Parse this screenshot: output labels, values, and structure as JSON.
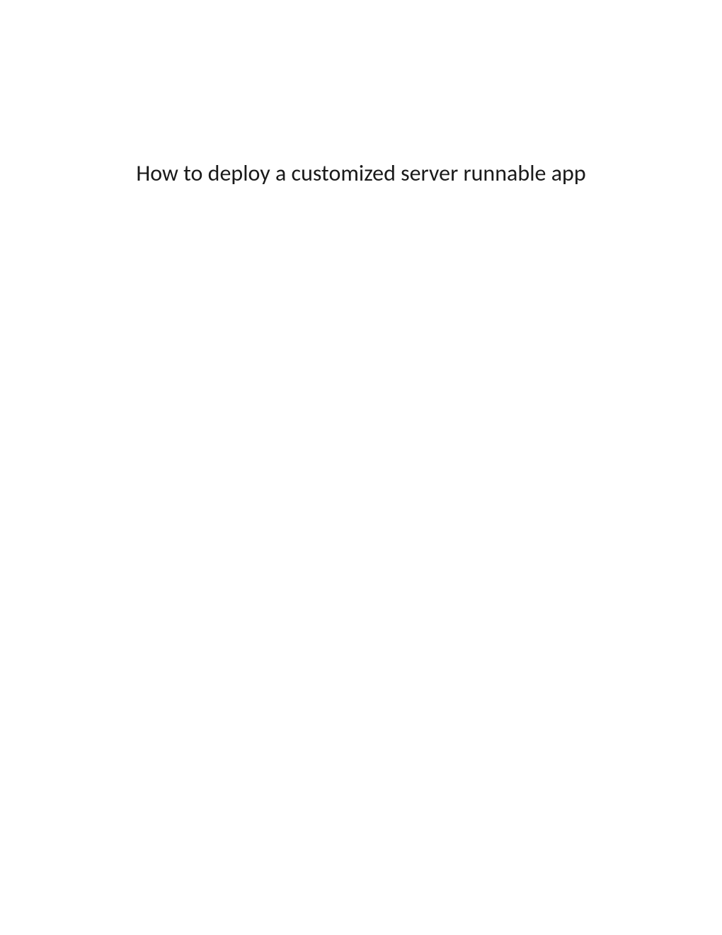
{
  "document": {
    "title": "How to deploy a customized server runnable app"
  }
}
